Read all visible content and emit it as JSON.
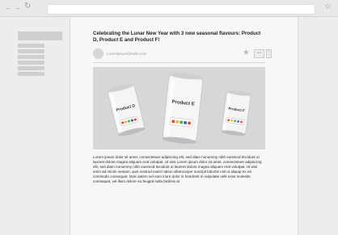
{
  "browser": {
    "back_icon": "back-arrow-icon",
    "forward_icon": "forward-arrow-icon",
    "reload_icon": "reload-icon",
    "bookmark_icon": "star-icon"
  },
  "email": {
    "subject": "Celebrating the Lunar New Year with 3 new seasonal flavours: Product D, Product E and Product F!",
    "sender_email": "Loremipsum@hello.com",
    "actions": {
      "star_icon": "star-icon",
      "reply_icon": "reply-icon",
      "more_icon": "more-icon"
    },
    "hero": {
      "cans": [
        {
          "label": "Product D"
        },
        {
          "label": "Product E"
        },
        {
          "label": "Product F"
        }
      ]
    },
    "body": "Lorem ipsum dolor sit amet, consectetuer adipiscing elit, sed diam nonummy nibh euismod tincidunt ut laoreet dolore magna aliquam erat volutpat. Ut wisi Lorem ipsum dolor sit amet, consectetuer adipiscing elit, sed diam nonummy nibh euismod tincidunt ut laoreet dolore magna aliquam erat volutpat. Ut wisi enim ad minim veniam, quis nostrud exerci tation ullamcorper suscipit lobortis nisl ut aliquip ex ea commodo consequat. Duis autem vel eum iriure dolor in hendrerit in vulputate velit esse molestie consequat, vel illum dolore eu feugiat nulla facilisis at"
  },
  "colors": {
    "badge": [
      "#e04a3a",
      "#f0b429",
      "#4caf50",
      "#2b6cb0"
    ]
  }
}
